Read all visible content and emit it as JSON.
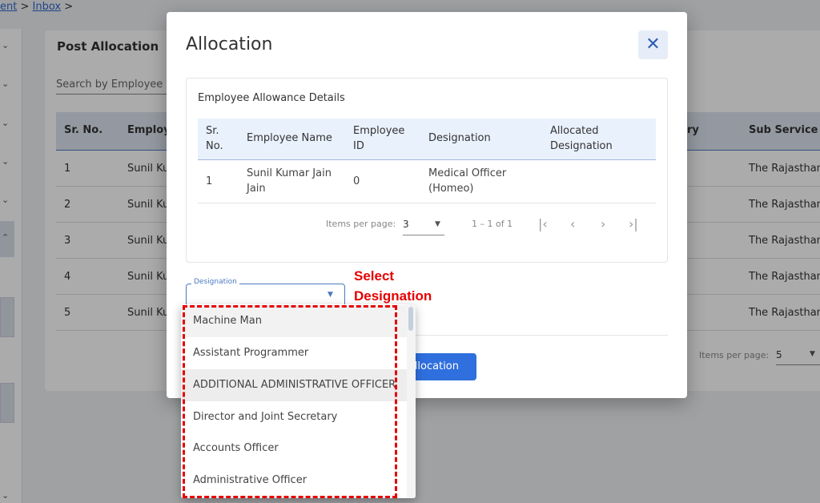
{
  "breadcrumb": {
    "items": [
      "ent",
      "Inbox"
    ]
  },
  "background": {
    "title": "Post Allocation",
    "search_placeholder": "Search by Employee",
    "columns": [
      "Sr. No.",
      "Employ",
      "ry",
      "Sub Service C"
    ],
    "rows": [
      {
        "sr": "1",
        "name": "Sunil Ku",
        "sub": "The Rajasthan"
      },
      {
        "sr": "2",
        "name": "Sunil Ku",
        "sub": "The Rajasthan"
      },
      {
        "sr": "3",
        "name": "Sunil Ku",
        "sub": "The Rajasthan"
      },
      {
        "sr": "4",
        "name": "Sunil Ku",
        "sub": "The Rajasthan"
      },
      {
        "sr": "5",
        "name": "Sunil Ku",
        "sub": "The Rajasthan"
      }
    ],
    "items_per_page_label": "Items per page:",
    "items_per_page": "5"
  },
  "modal": {
    "title": "Allocation",
    "close_icon": "close-icon",
    "section_title": "Employee Allowance Details",
    "columns": [
      "Sr. No.",
      "Employee Name",
      "Employee ID",
      "Designation",
      "Allocated Designation"
    ],
    "rows": [
      {
        "sr": "1",
        "name": "Sunil Kumar Jain Jain",
        "id": "0",
        "designation": "Medical Officer (Homeo)",
        "allocated": ""
      }
    ],
    "paginator": {
      "label": "Items per page:",
      "value": "3",
      "range": "1 – 1 of 1"
    },
    "designation_field": {
      "label": "Designation",
      "value": ""
    },
    "submit_label": "Allocation"
  },
  "dropdown": {
    "options": [
      "Machine Man",
      "Assistant Programmer",
      "ADDITIONAL ADMINISTRATIVE OFFICER",
      "Director and Joint Secretary",
      "Accounts Officer",
      "Administrative Officer"
    ],
    "highlighted": [
      "Machine Man",
      "ADDITIONAL ADMINISTRATIVE OFFICER"
    ]
  },
  "annotation": {
    "line1": "Select",
    "line2": "Designation",
    "color": "#e60000"
  },
  "colors": {
    "accent": "#2f6fde",
    "header_bg": "#e9f1fc"
  }
}
